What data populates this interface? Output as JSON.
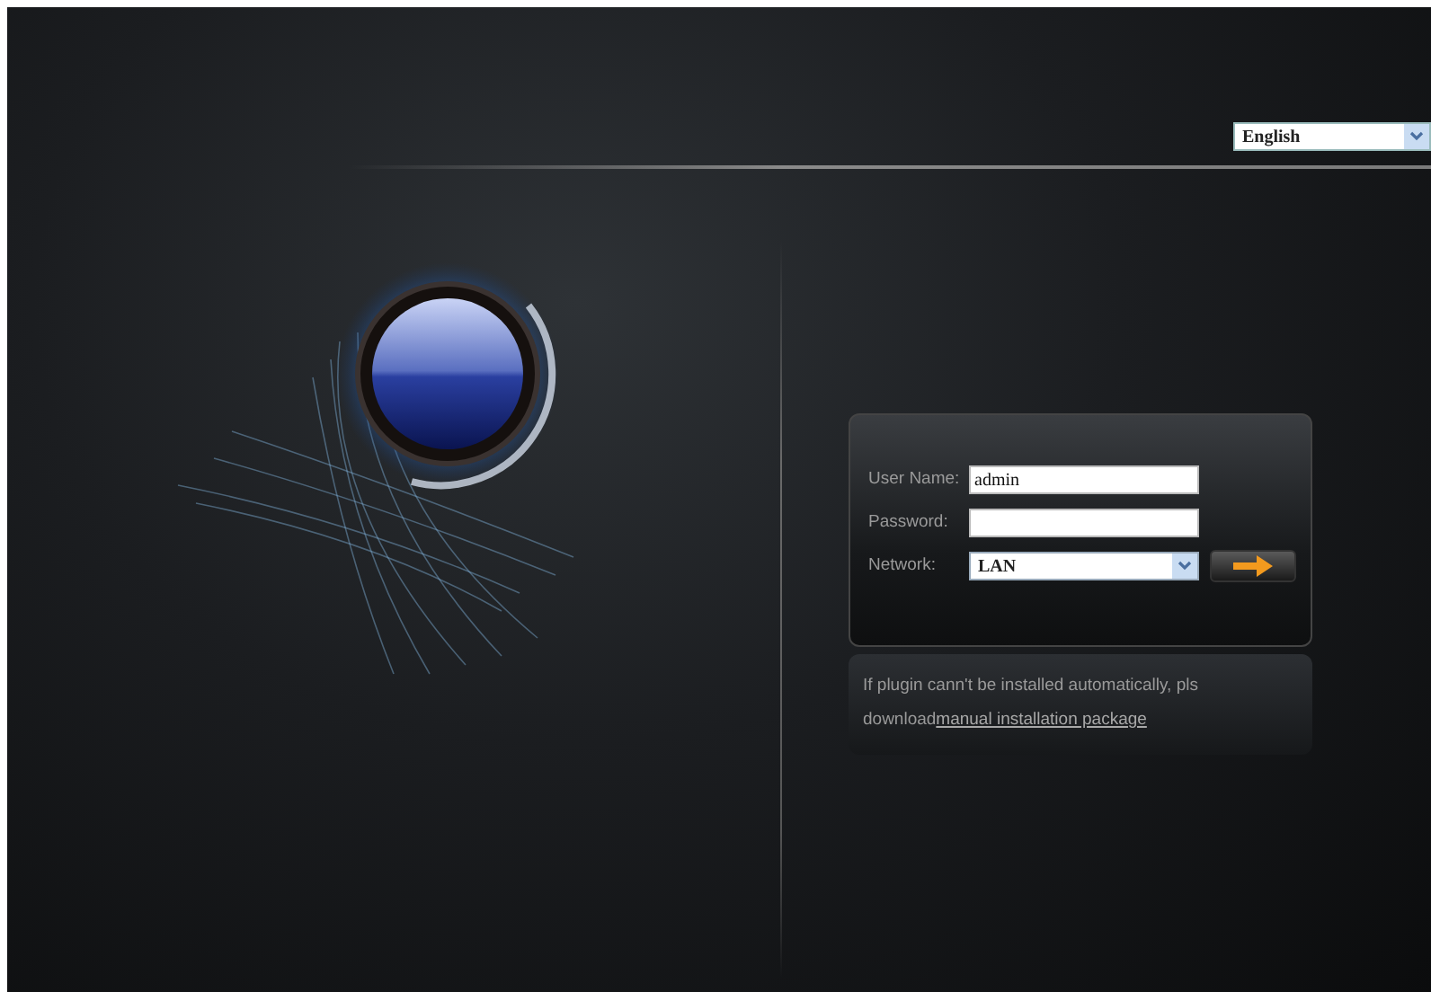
{
  "language_select": {
    "value": "English"
  },
  "login_form": {
    "fields": [
      {
        "kind": "text",
        "label": "User Name:",
        "value": "admin"
      },
      {
        "kind": "password",
        "label": "Password:"
      },
      {
        "kind": "select",
        "label": "Network:",
        "value": "LAN"
      }
    ]
  },
  "plugin_note": {
    "text": "If plugin cann't be installed automatically, pls download",
    "link": "manual installation package"
  }
}
